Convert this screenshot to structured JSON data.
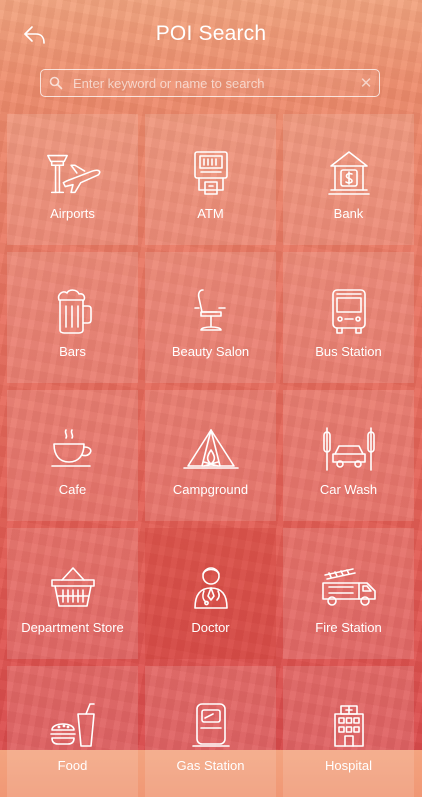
{
  "header": {
    "title": "POI Search",
    "back_icon": "back-arrow-icon"
  },
  "search": {
    "placeholder": "Enter keyword or name to search",
    "value": "",
    "clear_glyph": "✕"
  },
  "categories": [
    {
      "label": "Airports",
      "icon": "airport-icon"
    },
    {
      "label": "ATM",
      "icon": "atm-icon"
    },
    {
      "label": "Bank",
      "icon": "bank-icon"
    },
    {
      "label": "Bars",
      "icon": "beer-mug-icon"
    },
    {
      "label": "Beauty Salon",
      "icon": "salon-chair-icon"
    },
    {
      "label": "Bus Station",
      "icon": "bus-icon"
    },
    {
      "label": "Cafe",
      "icon": "coffee-cup-icon"
    },
    {
      "label": "Campground",
      "icon": "tent-icon"
    },
    {
      "label": "Car Wash",
      "icon": "car-wash-icon"
    },
    {
      "label": "Department Store",
      "icon": "basket-icon"
    },
    {
      "label": "Doctor",
      "icon": "doctor-icon"
    },
    {
      "label": "Fire Station",
      "icon": "fire-truck-icon"
    },
    {
      "label": "Food",
      "icon": "food-icon"
    },
    {
      "label": "Gas Station",
      "icon": "gas-pump-icon"
    },
    {
      "label": "Hospital",
      "icon": "hospital-icon"
    }
  ]
}
